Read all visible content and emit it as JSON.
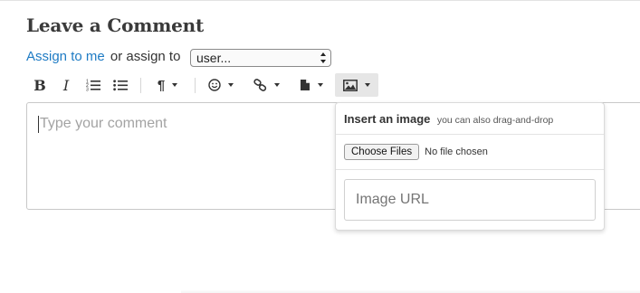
{
  "header": {
    "title": "Leave a Comment"
  },
  "assign": {
    "assign_to_me": "Assign to me",
    "or_assign_to": "or assign to",
    "user_select_value": "user..."
  },
  "toolbar": {
    "bold": "B",
    "italic": "I",
    "buttons": [
      "bold-icon",
      "italic-icon",
      "ordered-list-icon",
      "unordered-list-icon",
      "paragraph-icon",
      "emoji-icon",
      "link-icon",
      "file-icon",
      "image-icon"
    ]
  },
  "editor": {
    "placeholder": "Type your comment"
  },
  "image_popover": {
    "title": "Insert an image",
    "hint": "you can also drag-and-drop",
    "choose_files": "Choose Files",
    "file_status": "No file chosen",
    "url_placeholder": "Image URL"
  },
  "colors": {
    "link": "#1e7bc4",
    "active_button_bg": "#e6e6e6"
  }
}
